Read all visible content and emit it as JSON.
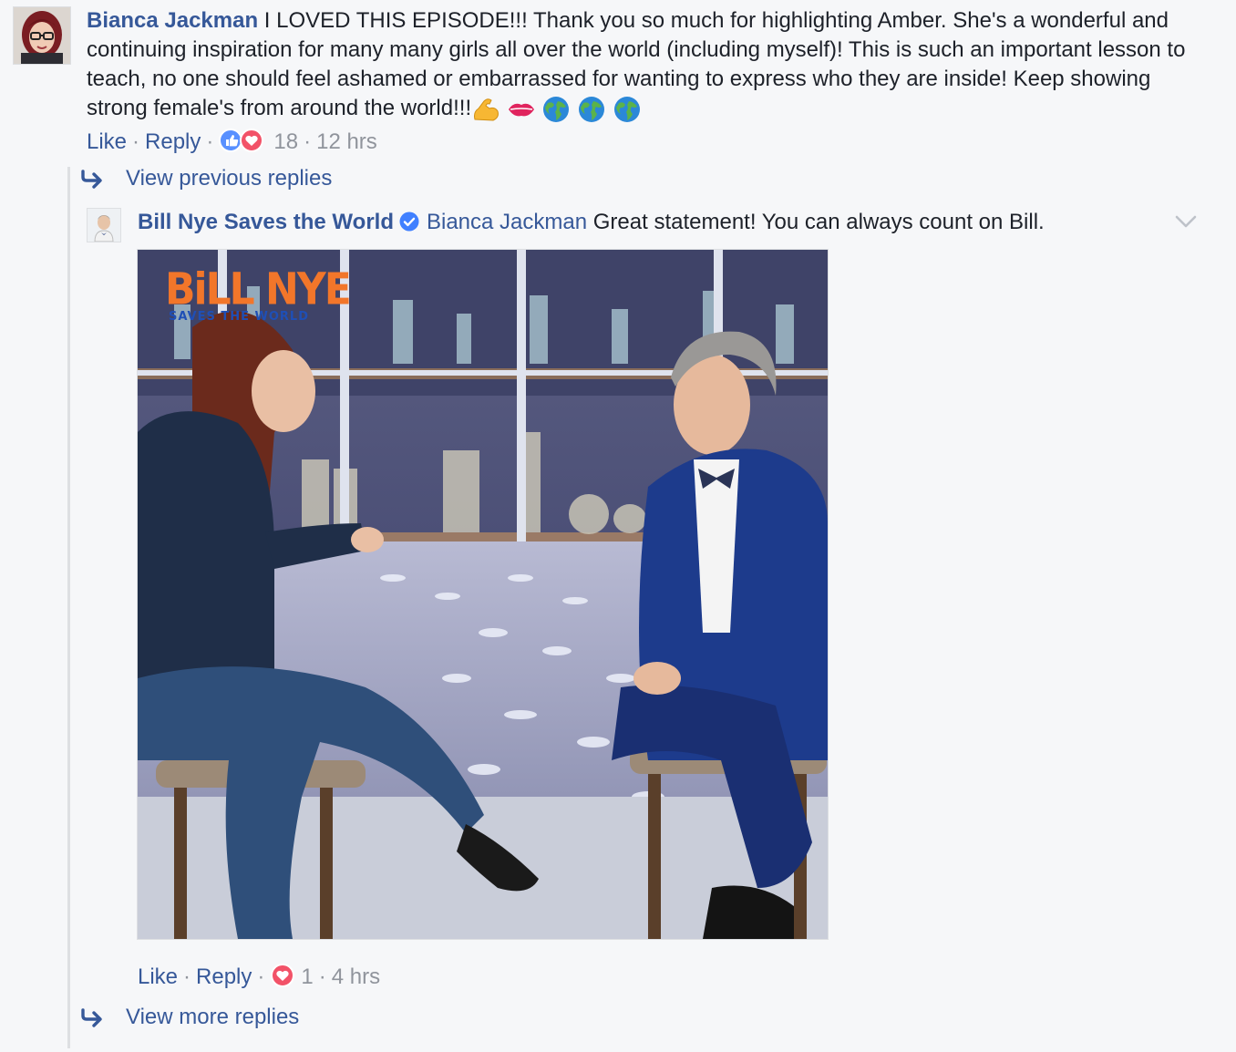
{
  "comment": {
    "author": "Bianca Jackman",
    "text": "I LOVED THIS EPISODE!!! Thank you so much for highlighting Amber. She's a wonderful and continuing inspiration for many many girls all over the world (including myself)! This is such an important lesson to teach, no one should feel ashamed or embarrassed for wanting to express who they are inside! Keep showing strong female's from around the world!!!",
    "emojis": [
      "flexed-biceps-emoji",
      "lips-emoji",
      "globe-emoji",
      "globe-emoji",
      "globe-emoji"
    ],
    "actions": {
      "like": "Like",
      "reply": "Reply",
      "reaction_count": "18",
      "time": "12 hrs"
    }
  },
  "view_previous": "View previous replies",
  "reply": {
    "author": "Bill Nye Saves the World",
    "mention": "Bianca Jackman",
    "text": "Great statement! You can always count on Bill.",
    "media": {
      "logo_main": "BiLL NYE",
      "logo_sub": "SAVES THE WORLD"
    },
    "actions": {
      "like": "Like",
      "reply": "Reply",
      "reaction_count": "1",
      "time": "4 hrs"
    }
  },
  "view_more": "View more replies",
  "colors": {
    "link": "#365899",
    "muted": "#90949c",
    "like_blue": "#5890ff",
    "love_red": "#f25268",
    "verified": "#4080ff"
  }
}
